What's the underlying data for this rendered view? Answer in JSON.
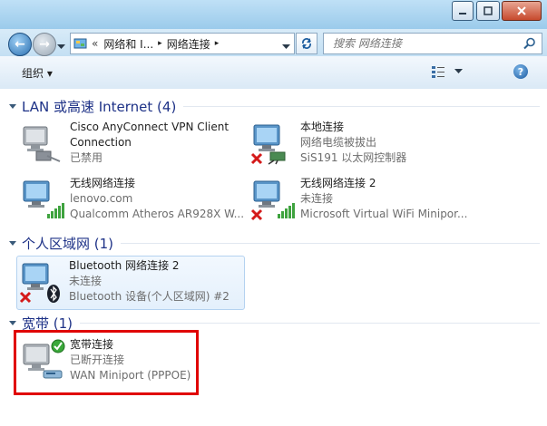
{
  "address": {
    "overflow": "«",
    "crumb1": "网络和 I...",
    "crumb2": "网络连接",
    "sep": "▸"
  },
  "search": {
    "placeholder": "搜索 网络连接"
  },
  "toolbar": {
    "organize": "组织 ▾"
  },
  "groups": {
    "lan": {
      "label": "LAN 或高速 Internet (4)"
    },
    "pan": {
      "label": "个人区域网 (1)"
    },
    "broadband": {
      "label": "宽带 (1)"
    }
  },
  "items": {
    "cisco": {
      "name": "Cisco AnyConnect VPN Client",
      "name2": "Connection",
      "status": "已禁用"
    },
    "local": {
      "name": "本地连接",
      "status": "网络电缆被拔出",
      "device": "SiS191 以太网控制器"
    },
    "wifi": {
      "name": "无线网络连接",
      "status": "lenovo.com",
      "device": "Qualcomm Atheros AR928X W..."
    },
    "wifi2": {
      "name": "无线网络连接 2",
      "status": "未连接",
      "device": "Microsoft Virtual WiFi Minipor..."
    },
    "bt": {
      "name": "Bluetooth 网络连接 2",
      "status": "未连接",
      "device": "Bluetooth 设备(个人区域网) #2"
    },
    "broadband": {
      "name": "宽带连接",
      "status": "已断开连接",
      "device": "WAN Miniport (PPPOE)"
    }
  },
  "colors": {
    "group_header": "#1e3287",
    "highlight": "#e00000",
    "accent": "#2a6fb0"
  }
}
